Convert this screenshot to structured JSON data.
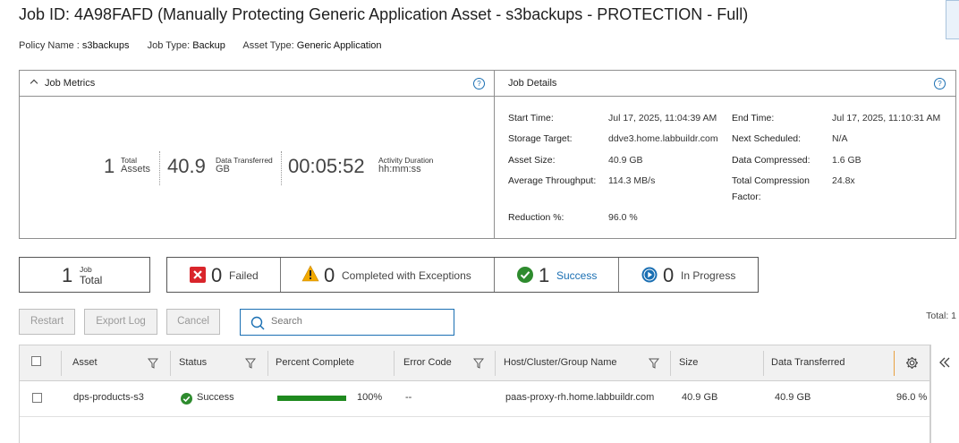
{
  "header": {
    "title": "Job ID: 4A98FAFD (Manually Protecting Generic Application Asset - s3backups - PROTECTION - Full)",
    "policy_label": "Policy Name :",
    "policy_value": "s3backups",
    "jobtype_label": "Job Type:",
    "jobtype_value": "Backup",
    "assettype_label": "Asset Type:",
    "assettype_value": "Generic Application"
  },
  "metrics": {
    "title": "Job Metrics",
    "assets_value": "1",
    "assets_top": "Total",
    "assets_unit": "Assets",
    "data_value": "40.9",
    "data_top": "Data Transferred",
    "data_unit": "GB",
    "duration_value": "00:05:52",
    "duration_top": "Activity Duration",
    "duration_unit": "hh:mm:ss"
  },
  "details": {
    "title": "Job Details",
    "start_label": "Start Time:",
    "start_value": "Jul 17, 2025, 11:04:39 AM",
    "end_label": "End Time:",
    "end_value": "Jul 17, 2025, 11:10:31 AM",
    "storage_label": "Storage Target:",
    "storage_value": "ddve3.home.labbuildr.com",
    "next_label": "Next Scheduled:",
    "next_value": "N/A",
    "size_label": "Asset Size:",
    "size_value": "40.9 GB",
    "compressed_label": "Data Compressed:",
    "compressed_value": "1.6 GB",
    "throughput_label": "Average Throughput:",
    "throughput_value": "114.3 MB/s",
    "compression_label_1": "Total Compression",
    "compression_label_2": "Factor:",
    "compression_value": "24.8x",
    "reduction_label": "Reduction %:",
    "reduction_value": "96.0 %"
  },
  "summary": {
    "total_value": "1",
    "total_top": "Job",
    "total_label": "Total",
    "failed_value": "0",
    "failed_label": "Failed",
    "exceptions_value": "0",
    "exceptions_label": "Completed with Exceptions",
    "success_value": "1",
    "success_label": "Success",
    "progress_value": "0",
    "progress_label": "In Progress"
  },
  "toolbar": {
    "restart": "Restart",
    "export": "Export Log",
    "cancel": "Cancel",
    "search_placeholder": "Search",
    "total": "Total: 1"
  },
  "table": {
    "columns": [
      "Asset",
      "Status",
      "Percent Complete",
      "Error Code",
      "Host/Cluster/Group Name",
      "Size",
      "Data Transferred"
    ],
    "rows": [
      {
        "asset": "dps-products-s3",
        "status": "Success",
        "percent": "100%",
        "percent_fraction": 1.0,
        "error": "--",
        "host": "paas-proxy-rh.home.labbuildr.com",
        "size": "40.9 GB",
        "transferred": "40.9 GB",
        "reduction": "96.0 %"
      }
    ]
  },
  "colors": {
    "accent": "#1a6fb3",
    "success": "#2e8b2e",
    "failed": "#d9252b",
    "warning": "#f2a900"
  }
}
